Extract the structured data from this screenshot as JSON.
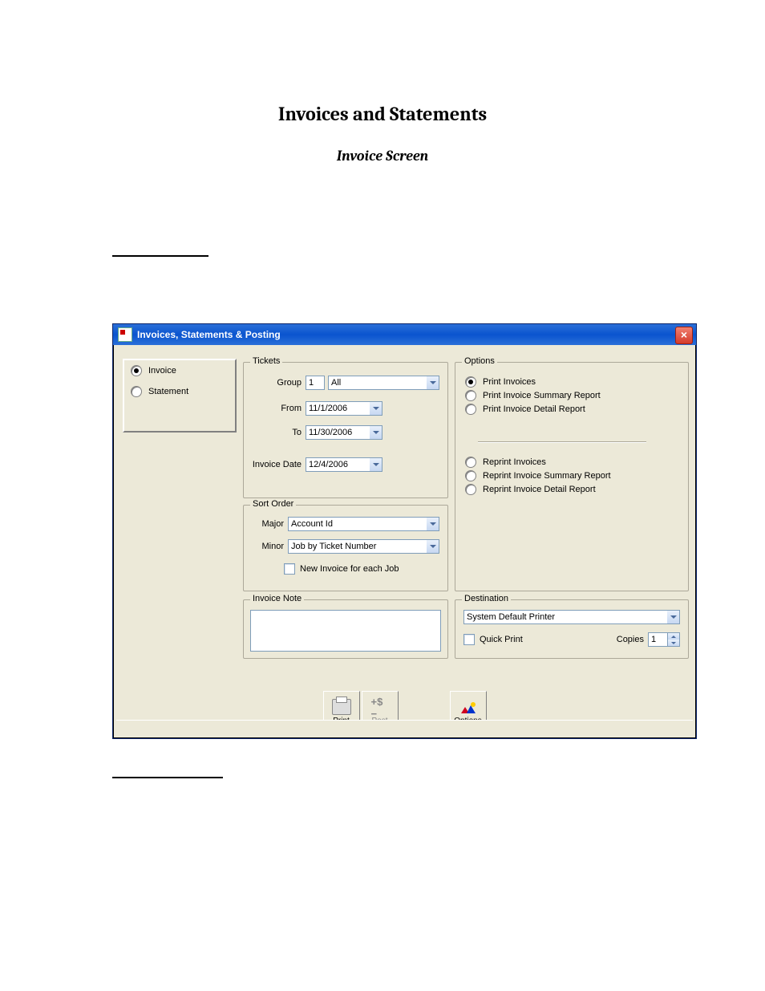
{
  "document": {
    "title": "Invoices and Statements",
    "subtitle": "Invoice Screen"
  },
  "window": {
    "title": "Invoices, Statements & Posting"
  },
  "mode": {
    "invoice": "Invoice",
    "statement": "Statement"
  },
  "tickets": {
    "legend": "Tickets",
    "group_label": "Group",
    "group_value": "1",
    "group_select_value": "All",
    "from_label": "From",
    "from_value": "11/1/2006",
    "to_label": "To",
    "to_value": "11/30/2006",
    "invoice_date_label": "Invoice Date",
    "invoice_date_value": "12/4/2006"
  },
  "sort_order": {
    "legend": "Sort Order",
    "major_label": "Major",
    "major_value": "Account Id",
    "minor_label": "Minor",
    "minor_value": "Job by Ticket Number",
    "new_invoice_label": "New Invoice for each Job"
  },
  "invoice_note": {
    "legend": "Invoice Note",
    "value": ""
  },
  "options": {
    "legend": "Options",
    "items_a": [
      "Print Invoices",
      "Print Invoice Summary Report",
      "Print Invoice Detail Report"
    ],
    "items_b": [
      "Reprint Invoices",
      "Reprint Invoice Summary Report",
      "Reprint Invoice Detail Report"
    ]
  },
  "destination": {
    "legend": "Destination",
    "printer": "System Default Printer",
    "quick_print_label": "Quick Print",
    "copies_label": "Copies",
    "copies_value": "1"
  },
  "toolbar": {
    "print": "Print",
    "post": "Post",
    "options": "Options"
  }
}
